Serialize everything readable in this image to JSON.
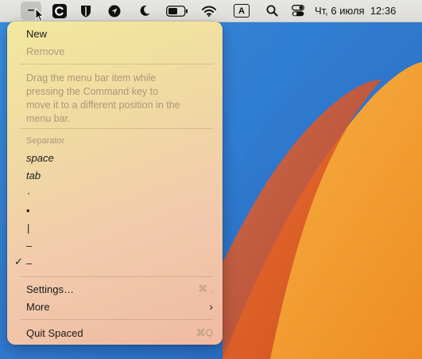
{
  "menubar": {
    "active_item_glyph": "–",
    "icons": [
      "spaced-dash-icon",
      "c-app-icon",
      "shield-icon",
      "compass-arrow-icon",
      "moon-icon",
      "battery-icon",
      "wifi-icon",
      "input-source-a-icon",
      "search-icon",
      "control-center-icon"
    ],
    "input_source_label": "A",
    "clock": "Чт, 6 июля  12:36"
  },
  "menu": {
    "new": "New",
    "remove": "Remove",
    "note": "Drag the menu bar item while pressing the Command key to move it to a different position in the menu bar.",
    "separator_header": "Separator",
    "separator_options": [
      "space",
      "tab",
      "·",
      "•",
      "|",
      "–",
      "–"
    ],
    "checked_option_index": 6,
    "checkmark": "✓",
    "settings": "Settings…",
    "settings_shortcut": "⌘ ,",
    "more": "More",
    "more_arrow": "›",
    "quit": "Quit Spaced",
    "quit_shortcut": "⌘Q"
  },
  "colors": {
    "menubar_bg": "#e3e2df",
    "menu_tint": "#fbe0a8",
    "wallpaper_blue": "#2d7bd1",
    "wallpaper_orange": "#f19a2a",
    "wallpaper_red": "#d9512a"
  }
}
